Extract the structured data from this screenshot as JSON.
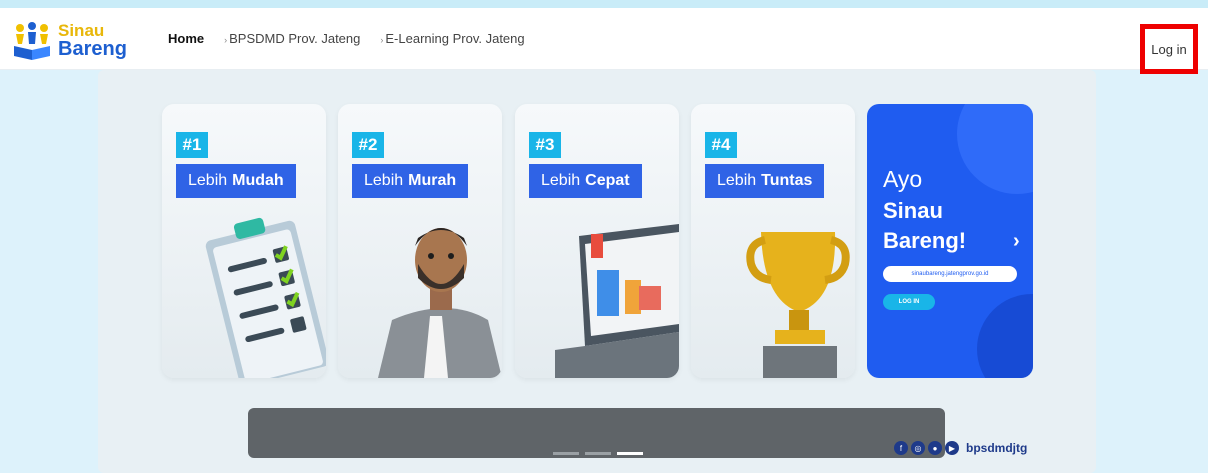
{
  "header": {
    "logo": {
      "line1": "Sinau",
      "line2": "Bareng"
    },
    "nav": [
      {
        "label": "Home",
        "caret": ""
      },
      {
        "label": "BPSDMD Prov. Jateng",
        "caret": "›"
      },
      {
        "label": "E-Learning Prov. Jateng",
        "caret": "›"
      }
    ],
    "login_label": "Log in"
  },
  "slider": {
    "cards": [
      {
        "num": "#1",
        "label_prefix": "Lebih",
        "label_bold": "Mudah",
        "icon": "checklist-clipboard-icon"
      },
      {
        "num": "#2",
        "label_prefix": "Lebih",
        "label_bold": "Murah",
        "icon": "businessman-avatar-icon"
      },
      {
        "num": "#3",
        "label_prefix": "Lebih",
        "label_bold": "Cepat",
        "icon": "laptop-chart-icon"
      },
      {
        "num": "#4",
        "label_prefix": "Lebih",
        "label_bold": "Tuntas",
        "icon": "trophy-icon"
      }
    ],
    "cta": {
      "line1": "Ayo",
      "line2": "Sinau",
      "line3": "Bareng!",
      "url": "sinaubareng.jatengprov.go.id",
      "button": "LOG IN"
    },
    "prev_arrow": "‹",
    "next_arrow": "›"
  },
  "social": {
    "icons": [
      "facebook-icon",
      "instagram-icon",
      "twitter-icon",
      "youtube-icon"
    ],
    "handle": "bpsdmdjtg"
  },
  "colors": {
    "accent": "#2f63e6",
    "badge": "#19b5e8",
    "highlight_border": "#ee0000",
    "background": "#ddf2fb"
  }
}
